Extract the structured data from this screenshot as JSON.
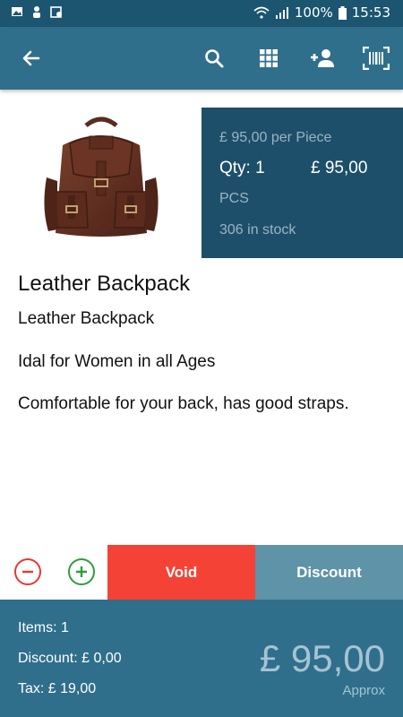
{
  "status_bar": {
    "battery": "100%",
    "time": "15:53",
    "icons": [
      "image-icon",
      "person-icon",
      "calendar-icon",
      "wifi-icon",
      "signal-icon",
      "battery-icon"
    ]
  },
  "toolbar": {
    "icons": [
      "back-arrow-icon",
      "search-icon",
      "grid-icon",
      "add-person-icon",
      "barcode-icon"
    ]
  },
  "product": {
    "unit_price": "£ 95,00 per Piece",
    "qty": "Qty: 1",
    "line_total": "£ 95,00",
    "unit_name": "PCS",
    "stock": "306 in stock",
    "title": "Leather Backpack",
    "description_lines": [
      "Leather Backpack",
      "Idal for Women in all Ages",
      "Comfortable for your back, has good straps."
    ]
  },
  "actions": {
    "void_label": "Void",
    "discount_label": "Discount"
  },
  "summary": {
    "items": "Items: 1",
    "discount": "Discount: £ 0,00",
    "tax": "Tax: £ 19,00",
    "total": "£ 95,00",
    "approx": "Approx"
  },
  "colors": {
    "status_bar": "#1c5570",
    "toolbar": "#2f6f8c",
    "price_panel": "#1e4f6a",
    "void": "#f44336",
    "discount": "#5e93a8",
    "footer": "#2f6f8c"
  }
}
